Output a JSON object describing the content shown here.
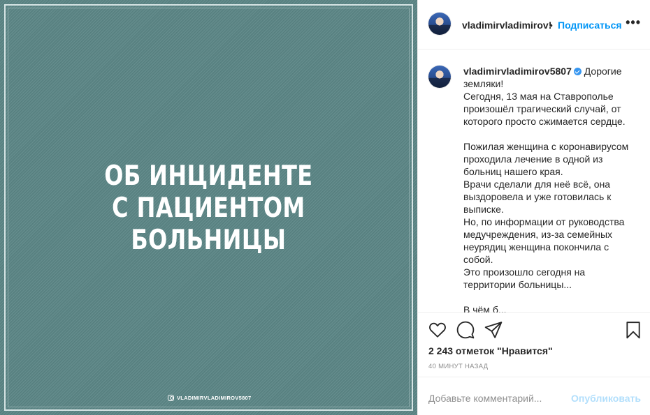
{
  "media": {
    "headline_lines": [
      "ОБ ИНЦИДЕНТЕ",
      "С ПАЦИЕНТОМ",
      "БОЛЬНИЦЫ"
    ],
    "watermark": "VLADIMIRVLADIMIROV5807",
    "background_color": "#5b8585"
  },
  "header": {
    "username": "vladimirvladimirov!",
    "separator": "•",
    "follow_label": "Подписаться",
    "more_label": "•••"
  },
  "caption": {
    "username": "vladimirvladimirov5807",
    "text": "Дорогие земляки!\nСегодня, 13 мая на Ставрополье произошёл трагический случай, от которого просто сжимается сердце.\n\nПожилая женщина с коронавирусом проходила лечение в одной из больниц нашего края.\nВрачи сделали для неё всё, она выздоровела и уже готовилась к выписке.\nНо, по информации от руководства медучреждения, из-за семейных неурядиц женщина покончила с собой.\nЭто произошло сегодня на территории больницы...\n\nВ чём б..."
  },
  "actions": {
    "likes": "2 243 отметок \"Нравится\"",
    "timestamp": "40 МИНУТ НАЗАД"
  },
  "comment": {
    "placeholder": "Добавьте комментарий...",
    "publish_label": "Опубликовать"
  },
  "colors": {
    "accent": "#0095f6",
    "verified": "#3897f0",
    "publish_disabled": "#b2dffc"
  },
  "icons": [
    "heart-icon",
    "comment-icon",
    "share-icon",
    "bookmark-icon",
    "instagram-icon",
    "verified-icon",
    "more-icon"
  ]
}
